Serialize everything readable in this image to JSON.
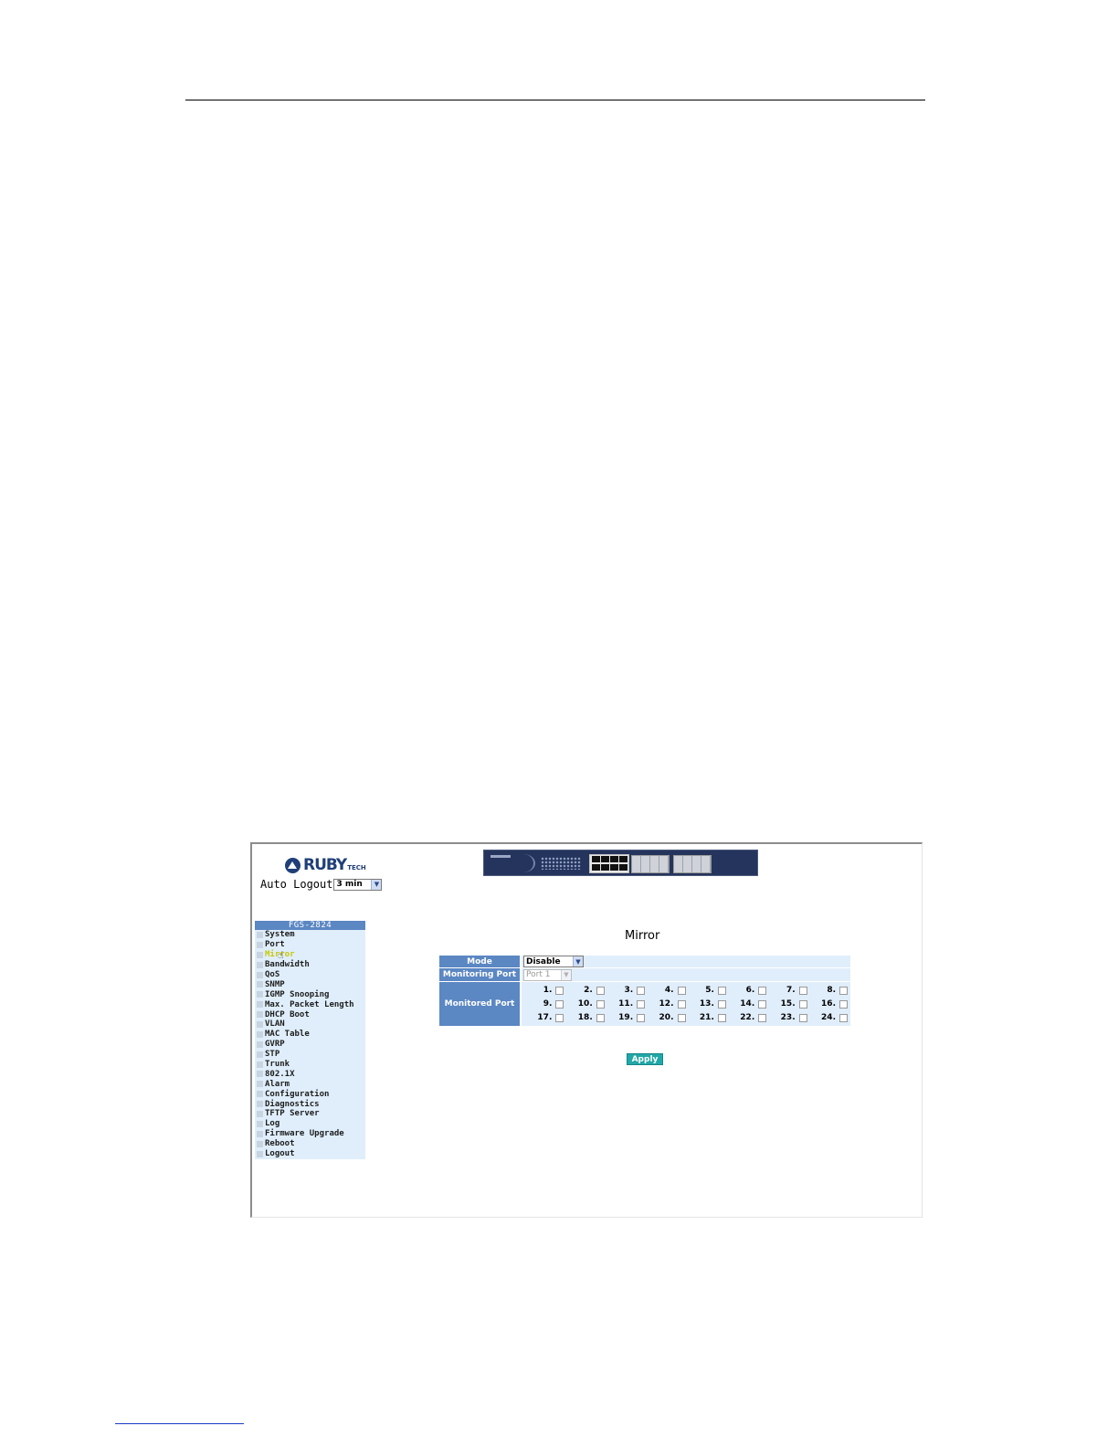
{
  "brand": {
    "logo_text": "RUBY",
    "logo_sub": "TECH"
  },
  "auto_logout": {
    "label": "Auto Logout",
    "value": "3 min"
  },
  "sidebar": {
    "header": "FGS-2824",
    "items": [
      {
        "label": "System"
      },
      {
        "label": "Port"
      },
      {
        "label": "Mirror",
        "active": true
      },
      {
        "label": "Bandwidth"
      },
      {
        "label": "QoS"
      },
      {
        "label": "SNMP"
      },
      {
        "label": "IGMP Snooping"
      },
      {
        "label": "Max. Packet Length"
      },
      {
        "label": "DHCP Boot"
      },
      {
        "label": "VLAN"
      },
      {
        "label": "MAC Table"
      },
      {
        "label": "GVRP"
      },
      {
        "label": "STP"
      },
      {
        "label": "Trunk"
      },
      {
        "label": "802.1X"
      },
      {
        "label": "Alarm"
      },
      {
        "label": "Configuration"
      },
      {
        "label": "Diagnostics"
      },
      {
        "label": "TFTP Server"
      },
      {
        "label": "Log"
      },
      {
        "label": "Firmware Upgrade"
      },
      {
        "label": "Reboot"
      },
      {
        "label": "Logout"
      }
    ]
  },
  "main": {
    "title": "Mirror",
    "mode": {
      "label": "Mode",
      "value": "Disable"
    },
    "monitoring_port": {
      "label": "Monitoring Port",
      "value": "Port 1",
      "disabled": true
    },
    "monitored_port": {
      "label": "Monitored Port",
      "ports": [
        "1.",
        "2.",
        "3.",
        "4.",
        "5.",
        "6.",
        "7.",
        "8.",
        "9.",
        "10.",
        "11.",
        "12.",
        "13.",
        "14.",
        "15.",
        "16.",
        "17.",
        "18.",
        "19.",
        "20.",
        "21.",
        "22.",
        "23.",
        "24."
      ],
      "checked": []
    },
    "apply_label": "Apply"
  },
  "colors": {
    "header_blue": "#5b87c3",
    "row_bg": "#e0edfb",
    "sidebar_bg": "#dfeefa",
    "apply": "#21a7a7"
  }
}
